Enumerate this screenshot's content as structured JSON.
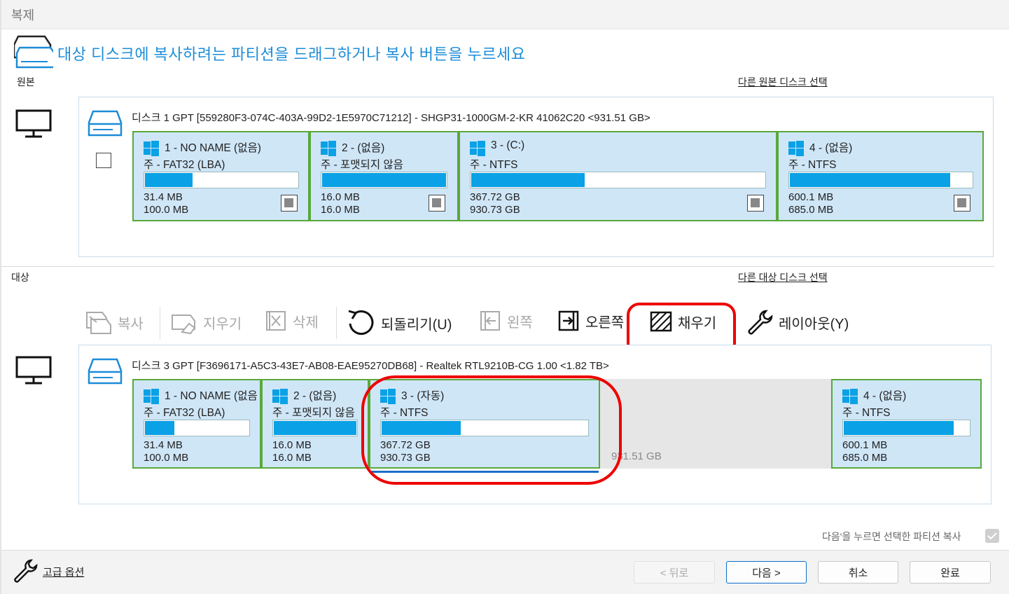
{
  "window": {
    "title": "복제"
  },
  "header": {
    "instruction": "대상 디스크에 복사하려는 파티션을 드래그하거나 복사 버튼을 누르세요"
  },
  "source": {
    "label": "원본",
    "select_link": "다른 원본 디스크 선택",
    "disk_title": "디스크 1 GPT [559280F3-074C-403A-99D2-1E5970C71212] - SHGP31-1000GM-2-KR 41062C20  <931.51 GB>",
    "partitions": [
      {
        "name": "1 - NO NAME (없음)",
        "type": "주 - FAT32 (LBA)",
        "used": "31.4 MB",
        "total": "100.0 MB",
        "fill": 0.32
      },
      {
        "name": "2 - (없음)",
        "type": "주 - 포맷되지 않음",
        "used": "16.0 MB",
        "total": "16.0 MB",
        "fill": 1.0
      },
      {
        "name": "3 - (C:)",
        "type": "주 - NTFS",
        "used": "367.72 GB",
        "total": "930.73 GB",
        "fill": 0.39
      },
      {
        "name": "4 - (없음)",
        "type": "주 - NTFS",
        "used": "600.1 MB",
        "total": "685.0 MB",
        "fill": 0.88
      }
    ]
  },
  "target": {
    "label": "대상",
    "select_link": "다른 대상 디스크 선택",
    "disk_title": "디스크 3 GPT [F3696171-A5C3-43E7-AB08-EAE95270DB68] - Realtek  RTL9210B-CG      1.00  <1.82 TB>",
    "partitions": [
      {
        "name": "1 - NO NAME (없음",
        "type": "주 - FAT32 (LBA)",
        "used": "31.4 MB",
        "total": "100.0 MB",
        "fill": 0.29
      },
      {
        "name": "2 - (없음)",
        "type": "주 - 포맷되지 않음",
        "used": "16.0 MB",
        "total": "16.0 MB",
        "fill": 1.0
      },
      {
        "name": "3 - (자동)",
        "type": "주 - NTFS",
        "used": "367.72 GB",
        "total": "930.73 GB",
        "fill": 0.39
      },
      {
        "name": "4 - (없음)",
        "type": "주 - NTFS",
        "used": "600.1 MB",
        "total": "685.0 MB",
        "fill": 0.88
      }
    ],
    "unallocated": "931.51 GB"
  },
  "toolbar": {
    "copy": "복사",
    "erase": "지우기",
    "delete": "삭제",
    "undo": "되돌리기(U)",
    "left": "왼쪽",
    "right": "오른쪽",
    "fill": "채우기",
    "layout": "레이아웃(Y)"
  },
  "note": "다음'을 누르면 선택한 파티션 복사",
  "footer": {
    "advanced": "고급 옵션",
    "back": "< 뒤로",
    "next": "다음 >",
    "cancel": "취소",
    "finish": "완료"
  },
  "colors": {
    "accent": "#1c8cd8",
    "partition_bg": "#cfe6f7",
    "partition_border": "#59a83a",
    "bar_fill": "#0aa1e6",
    "highlight": "#e00000"
  }
}
